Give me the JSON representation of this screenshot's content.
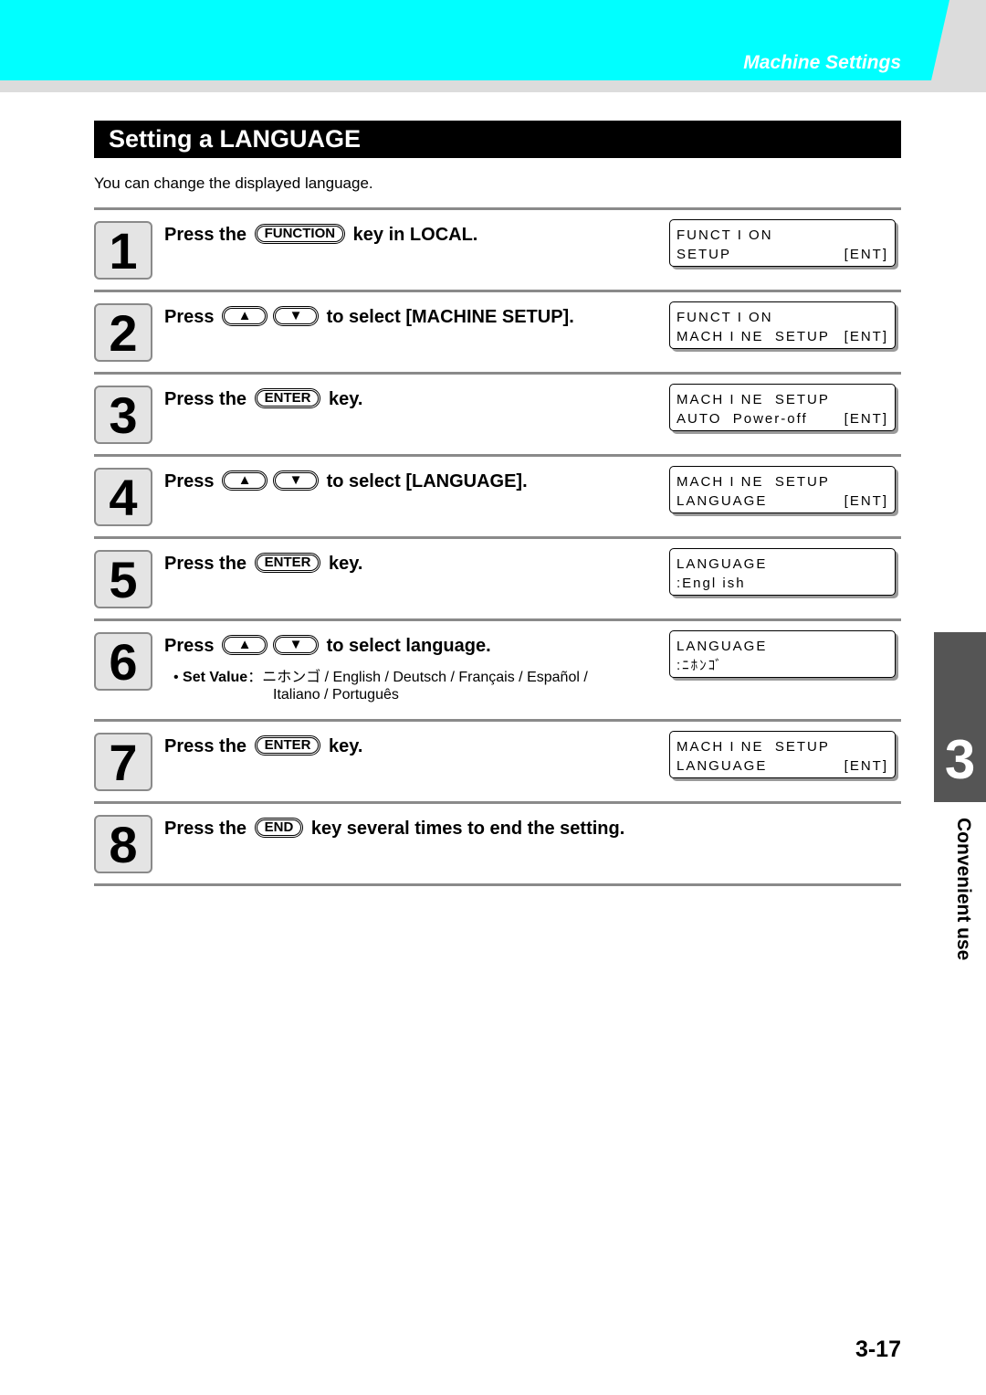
{
  "header": {
    "section": "Machine Settings"
  },
  "title": "Setting a LANGUAGE",
  "intro": "You can change the displayed language.",
  "steps": [
    {
      "number": "1",
      "parts": [
        {
          "t": "Press the "
        },
        {
          "k": "FUNCTION"
        },
        {
          "t": " key in LOCAL."
        }
      ],
      "lcd": [
        [
          "FUNCT I ON",
          ""
        ],
        [
          "SETUP",
          "[ENT]"
        ]
      ]
    },
    {
      "number": "2",
      "parts": [
        {
          "t": "Press "
        },
        {
          "k": "▲"
        },
        {
          "k": "▼"
        },
        {
          "t": " to select [MACHINE SETUP]."
        }
      ],
      "lcd": [
        [
          "FUNCT I ON",
          ""
        ],
        [
          "MACH I NE  SETUP",
          "[ENT]"
        ]
      ]
    },
    {
      "number": "3",
      "parts": [
        {
          "t": "Press the "
        },
        {
          "k": "ENTER"
        },
        {
          "t": " key."
        }
      ],
      "lcd": [
        [
          "MACH I NE  SETUP",
          ""
        ],
        [
          "AUTO  Power-off",
          "[ENT]"
        ]
      ]
    },
    {
      "number": "4",
      "parts": [
        {
          "t": "Press "
        },
        {
          "k": "▲"
        },
        {
          "k": "▼"
        },
        {
          "t": " to select [LANGUAGE]."
        }
      ],
      "lcd": [
        [
          "MACH I NE  SETUP",
          ""
        ],
        [
          "LANGUAGE",
          "[ENT]"
        ]
      ]
    },
    {
      "number": "5",
      "parts": [
        {
          "t": "Press the "
        },
        {
          "k": "ENTER"
        },
        {
          "t": " key."
        }
      ],
      "lcd": [
        [
          "LANGUAGE",
          ""
        ],
        [
          ":Engl ish",
          ""
        ]
      ]
    },
    {
      "number": "6",
      "parts": [
        {
          "t": "Press "
        },
        {
          "k": "▲"
        },
        {
          "k": "▼"
        },
        {
          "t": " to select language."
        }
      ],
      "lcd": [
        [
          "LANGUAGE",
          ""
        ],
        [
          ":ﾆﾎﾝｺﾞ",
          ""
        ]
      ],
      "set_value": {
        "label": "Set Value",
        "line1": "：ニホンゴ / English / Deutsch / Français / Español /",
        "line2": "Italiano / Português"
      }
    },
    {
      "number": "7",
      "parts": [
        {
          "t": "Press the "
        },
        {
          "k": "ENTER"
        },
        {
          "t": " key."
        }
      ],
      "lcd": [
        [
          "MACH I NE  SETUP",
          ""
        ],
        [
          "LANGUAGE",
          "[ENT]"
        ]
      ]
    },
    {
      "number": "8",
      "parts": [
        {
          "t": "Press the "
        },
        {
          "k": "END"
        },
        {
          "t": " key several times to end the setting."
        }
      ]
    }
  ],
  "side_tab": {
    "chapter": "3",
    "label": "Convenient use"
  },
  "page_number": "3-17",
  "colors": {
    "header": "#00ffff",
    "title_bar": "#000000",
    "side_tab": "#555555"
  }
}
